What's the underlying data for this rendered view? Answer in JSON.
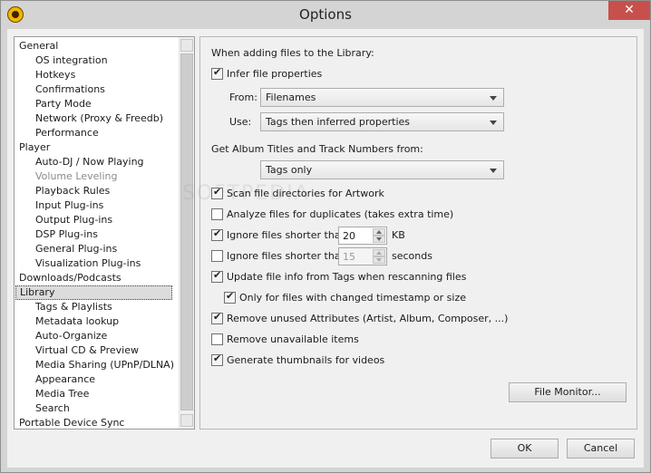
{
  "window": {
    "title": "Options",
    "close_glyph": "✕",
    "app_icon": "mediamonkey-icon"
  },
  "tree": {
    "items": [
      {
        "label": "General",
        "level": 0
      },
      {
        "label": "OS integration",
        "level": 1
      },
      {
        "label": "Hotkeys",
        "level": 1
      },
      {
        "label": "Confirmations",
        "level": 1
      },
      {
        "label": "Party Mode",
        "level": 1
      },
      {
        "label": "Network (Proxy & Freedb)",
        "level": 1
      },
      {
        "label": "Performance",
        "level": 1
      },
      {
        "label": "Player",
        "level": 0
      },
      {
        "label": "Auto-DJ / Now Playing",
        "level": 1
      },
      {
        "label": "Volume Leveling",
        "level": 1,
        "disabled": true
      },
      {
        "label": "Playback Rules",
        "level": 1
      },
      {
        "label": "Input Plug-ins",
        "level": 1
      },
      {
        "label": "Output Plug-ins",
        "level": 1
      },
      {
        "label": "DSP Plug-ins",
        "level": 1
      },
      {
        "label": "General Plug-ins",
        "level": 1
      },
      {
        "label": "Visualization Plug-ins",
        "level": 1
      },
      {
        "label": "Downloads/Podcasts",
        "level": 0
      },
      {
        "label": "Library",
        "level": 0,
        "selected": true
      },
      {
        "label": "Tags & Playlists",
        "level": 1
      },
      {
        "label": "Metadata lookup",
        "level": 1
      },
      {
        "label": "Auto-Organize",
        "level": 1
      },
      {
        "label": "Virtual CD & Preview",
        "level": 1
      },
      {
        "label": "Media Sharing (UPnP/DLNA)",
        "level": 1
      },
      {
        "label": "Appearance",
        "level": 1
      },
      {
        "label": "Media Tree",
        "level": 1
      },
      {
        "label": "Search",
        "level": 1
      },
      {
        "label": "Portable Device Sync",
        "level": 0
      }
    ]
  },
  "library": {
    "when_adding_heading": "When adding files to the Library:",
    "infer_properties": {
      "label": "Infer file properties",
      "checked": true
    },
    "from": {
      "label": "From:",
      "value": "Filenames"
    },
    "use": {
      "label": "Use:",
      "value": "Tags then inferred properties"
    },
    "album_titles_heading": "Get Album Titles and Track Numbers from:",
    "album_source": {
      "value": "Tags only"
    },
    "scan_artwork": {
      "label": "Scan file directories for Artwork",
      "checked": true
    },
    "analyze_duplicates": {
      "label": "Analyze files for duplicates (takes extra time)",
      "checked": false
    },
    "ignore_kb": {
      "label": "Ignore files shorter than",
      "checked": true,
      "value": "20",
      "unit": "KB"
    },
    "ignore_seconds": {
      "label": "Ignore files shorter than",
      "checked": false,
      "value": "15",
      "unit": "seconds"
    },
    "update_from_tags": {
      "label": "Update file info from Tags when rescanning files",
      "checked": true
    },
    "only_changed_timestamp": {
      "label": "Only for files with changed timestamp or size",
      "checked": true
    },
    "remove_unused_attributes": {
      "label": "Remove unused Attributes (Artist, Album, Composer, ...)",
      "checked": true
    },
    "remove_unavailable": {
      "label": "Remove unavailable items",
      "checked": false
    },
    "generate_thumbnails": {
      "label": "Generate thumbnails for videos",
      "checked": true
    },
    "file_monitor_button": "File Monitor..."
  },
  "footer": {
    "ok": "OK",
    "cancel": "Cancel"
  },
  "watermark": "SOFTPEDIA"
}
